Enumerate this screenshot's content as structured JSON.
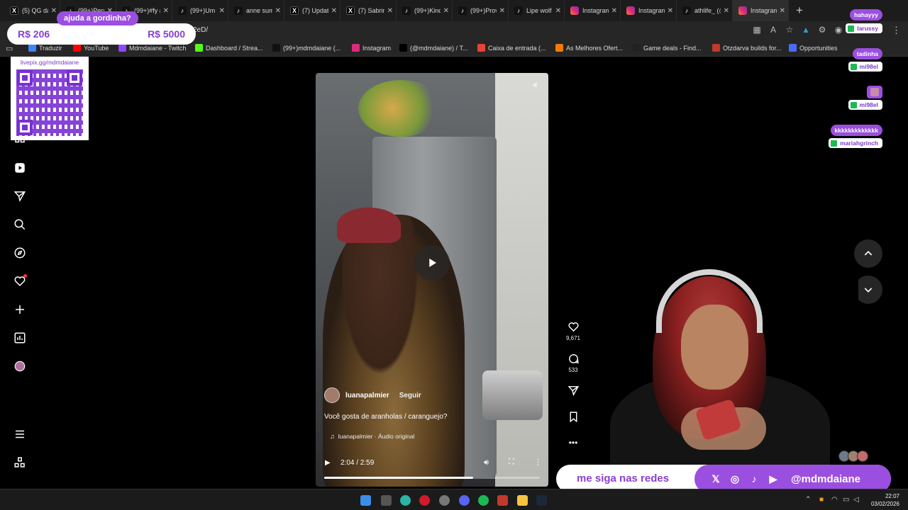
{
  "browser": {
    "tabs": [
      {
        "label": "(5) QG da",
        "icon": "x-icon",
        "active": false
      },
      {
        "label": "(99+)Pers",
        "icon": "tiktok-icon",
        "active": false
      },
      {
        "label": "(99+)#fy #",
        "icon": "tiktok-icon",
        "active": false
      },
      {
        "label": "(99+)Um p",
        "icon": "tiktok-icon",
        "active": false
      },
      {
        "label": "anne sum",
        "icon": "tiktok-icon",
        "active": false
      },
      {
        "label": "(7) Updat",
        "icon": "x-icon",
        "active": false
      },
      {
        "label": "(7) Sabrin",
        "icon": "x-icon",
        "active": false
      },
      {
        "label": "(99+)Kind",
        "icon": "tiktok-icon",
        "active": false
      },
      {
        "label": "(99+)Prov",
        "icon": "tiktok-icon",
        "active": false
      },
      {
        "label": "Lipe wolf",
        "icon": "tiktok-icon",
        "active": false
      },
      {
        "label": "Instagram",
        "icon": "instagram-icon",
        "active": false
      },
      {
        "label": "Instagram",
        "icon": "instagram-icon",
        "active": false
      },
      {
        "label": "athlife_ (@",
        "icon": "tiktok-icon",
        "active": false
      },
      {
        "label": "Instagram",
        "icon": "instagram-icon",
        "active": true
      }
    ],
    "url_fragment": "2eD/",
    "bookmarks": [
      {
        "label": "Traduzir",
        "color": "#4285f4"
      },
      {
        "label": "YouTube",
        "color": "#ff0000"
      },
      {
        "label": "Mdmdaiane - Twitch",
        "color": "#9146ff"
      },
      {
        "label": "Dashboard / Strea...",
        "color": "#53fc18"
      },
      {
        "label": "(99+)mdmdaiane (...",
        "color": "#111111"
      },
      {
        "label": "Instagram",
        "color": "#dd2a7b"
      },
      {
        "label": "(@mdmdaiane) / T...",
        "color": "#000000"
      },
      {
        "label": "Caixa de entrada (...",
        "color": "#ea4335"
      },
      {
        "label": "As Melhores Ofert...",
        "color": "#f57c00"
      },
      {
        "label": "Game deals - Find...",
        "color": "#222222"
      },
      {
        "label": "Otzdarva builds for...",
        "color": "#c0392b"
      },
      {
        "label": "Opportunities",
        "color": "#4a6cf7"
      }
    ]
  },
  "reel": {
    "author": "luanapalmier",
    "follow_label": "Seguir",
    "caption": "Você gosta de aranholas / caranguejo?",
    "audio": "luanapalmier · Áudio original",
    "time": "2:04 / 2:59",
    "progress": 0.69,
    "likes": "9,671",
    "comments": "533"
  },
  "overlay": {
    "donation_title": "ajuda a gordinha?",
    "donation_current": "R$ 206",
    "donation_goal": "R$ 5000",
    "qr_url": "livepix.gg/mdmdaiane",
    "chat": [
      {
        "type": "msg",
        "text": "hahayyy"
      },
      {
        "type": "user",
        "text": "larussy"
      },
      {
        "type": "msg",
        "text": "tadinha"
      },
      {
        "type": "user",
        "text": "mi98el"
      },
      {
        "type": "user",
        "text": "mi98el"
      },
      {
        "type": "msg",
        "text": "kkkkkkkkkkkkk"
      },
      {
        "type": "user",
        "text": "mariahgrinch"
      }
    ],
    "social_prompt": "me siga nas redes",
    "social_handle": "@mdmdaiane"
  },
  "taskbar": {
    "time": "22:07",
    "date": "03/02/2026"
  }
}
